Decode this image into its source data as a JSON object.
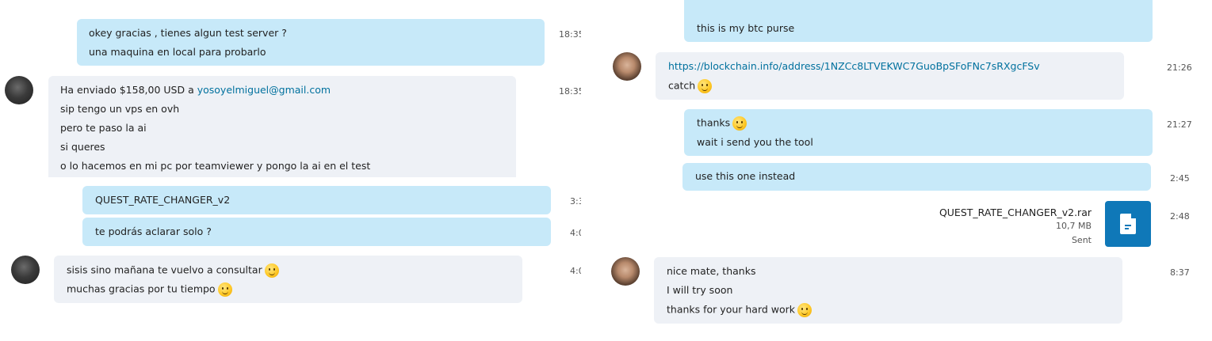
{
  "left": {
    "messages": [
      {
        "lines": [
          "okey gracias , tienes algun test server ?",
          "una maquina en local para probarlo"
        ],
        "time": "18:35"
      },
      {
        "payment_prefix": "Ha enviado $158,00 USD a ",
        "payment_email": "yosoyelmiguel@gmail.com",
        "lines": [
          "sip tengo un vps en ovh",
          "pero te paso la ai",
          "si queres",
          "o lo hacemos en mi pc por teamviewer y pongo la ai en el test"
        ],
        "time": "18:35"
      },
      {
        "lines": [
          "QUEST_RATE_CHANGER_v2"
        ],
        "time": "3:3"
      },
      {
        "lines": [
          "te podrás aclarar solo ?"
        ],
        "time": "4:0"
      },
      {
        "lines": [
          "sisis sino mañana te vuelvo a consultar",
          "muchas gracias por tu tiempo"
        ],
        "time": "4:0"
      }
    ]
  },
  "right": {
    "messages": [
      {
        "lines": [
          "this is my btc purse"
        ]
      },
      {
        "link": "https://blockchain.info/address/1NZCc8LTVEKWC7GuoBpSFoFNc7sRXgcFSv",
        "lines": [
          "catch"
        ],
        "time": "21:26"
      },
      {
        "lines": [
          "thanks",
          "wait i send you the tool"
        ],
        "time": "21:27"
      },
      {
        "lines": [
          "use this one instead"
        ],
        "time": "2:45"
      },
      {
        "file": {
          "name": "QUEST_RATE_CHANGER_v2.rar",
          "size": "10,7 MB",
          "status": "Sent"
        },
        "time": "2:48"
      },
      {
        "lines": [
          "nice mate, thanks",
          "I will try soon",
          "thanks for your hard work"
        ],
        "time": "8:37"
      }
    ]
  },
  "icons": {
    "emoji": "smiley-icon",
    "file": "file-icon"
  },
  "colors": {
    "outgoing_bubble": "#c7e9f9",
    "incoming_bubble": "#eef1f6",
    "link": "#00719e",
    "file_tile": "#0f78b8"
  }
}
